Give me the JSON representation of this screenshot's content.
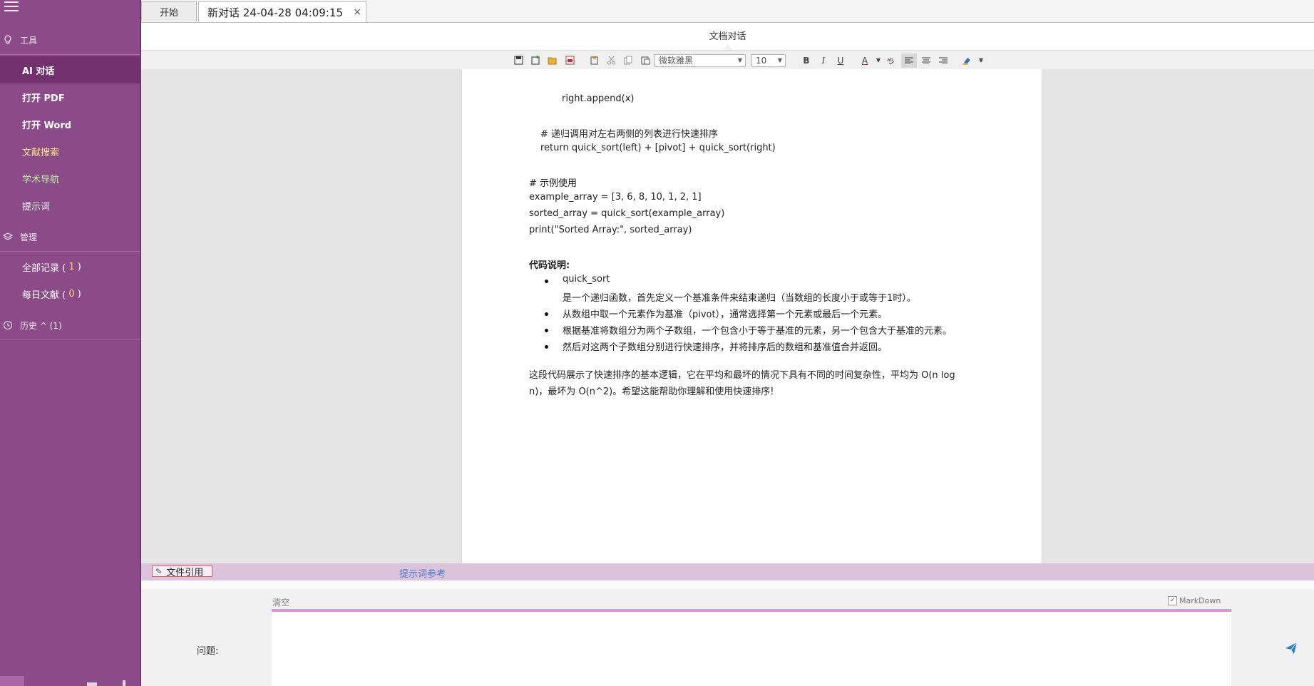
{
  "sidebar": {
    "tools_header": "工具",
    "items": [
      {
        "label": "AI 对话"
      },
      {
        "label": "打开 PDF"
      },
      {
        "label": "打开 Word"
      },
      {
        "label": "文献搜索"
      },
      {
        "label": "学术导航"
      },
      {
        "label": "提示词"
      }
    ],
    "manage_header": "管理",
    "records": [
      {
        "label": "全部记录 (",
        "count": "1",
        "suffix": ")"
      },
      {
        "label": "每日文献 (",
        "count": "0",
        "suffix": ")"
      }
    ],
    "history_header": "历史 ^ (1)"
  },
  "tabs": {
    "home": "开始",
    "chat": "新对话 24-04-28 04:09:15",
    "close": "×"
  },
  "doc": {
    "title": "文档对话"
  },
  "toolbar": {
    "font_name": "微软雅黑",
    "font_size": "10",
    "bold": "B",
    "italic": "I",
    "underline": "U",
    "font_color": "A"
  },
  "content": {
    "lines": [
      "right.append(x)",
      "# 递归调用对左右两侧的列表进行快速排序",
      "return quick_sort(left) + [pivot] + quick_sort(right)",
      "# 示例使用",
      "example_array = [3, 6, 8, 10, 1, 2, 1]",
      "sorted_array = quick_sort(example_array)",
      "print(\"Sorted Array:\", sorted_array)",
      "代码说明:",
      "quick_sort",
      "是一个递归函数，首先定义一个基准条件来结束递归（当数组的长度小于或等于1时）。",
      "从数组中取一个元素作为基准（pivot），通常选择第一个元素或最后一个元素。",
      "根据基准将数组分为两个子数组，一个包含小于等于基准的元素，另一个包含大于基准的元素。",
      "然后对这两个子数组分别进行快速排序，并将排序后的数组和基准值合并返回。",
      "这段代码展示了快速排序的基本逻辑，它在平均和最坏的情况下具有不同的时间复杂性，平均为 O(n log",
      "n)，最坏为 O(n^2)。希望这能帮助你理解和使用快速排序!"
    ]
  },
  "reference": {
    "file_ref": "文件引用",
    "prompt_ref": "提示词参考"
  },
  "input": {
    "clear": "清空",
    "markdown": "MarkDown",
    "question_label": "问题:"
  }
}
